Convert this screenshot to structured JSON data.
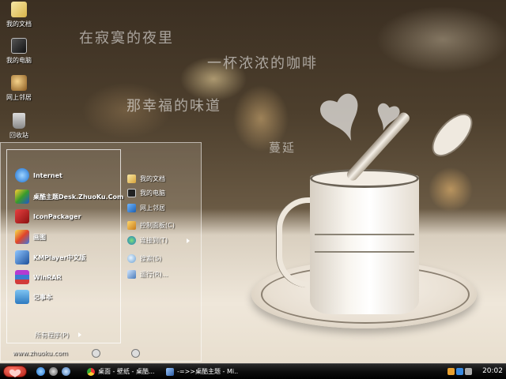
{
  "desktop": {
    "icons": [
      {
        "label": "我的文档",
        "icon": "my-documents-icon"
      },
      {
        "label": "我的电脑",
        "icon": "my-computer-icon"
      },
      {
        "label": "网上邻居",
        "icon": "network-places-icon"
      },
      {
        "label": "回收站",
        "icon": "recycle-bin-icon"
      }
    ],
    "wallpaper_text": [
      "在寂寞的夜里",
      "一杯浓浓的咖啡",
      "那幸福的味道",
      "蔓延"
    ]
  },
  "start_menu": {
    "pinned": [
      {
        "label": "Internet",
        "icon": "internet-explorer-icon"
      },
      {
        "label": "桌酷主题Desk.ZhuoKu.Com",
        "icon": "zhuoku-theme-icon"
      },
      {
        "label": "IconPackager",
        "icon": "iconpackager-icon"
      },
      {
        "label": "画图",
        "icon": "paint-icon"
      },
      {
        "label": "KMPlayer中文版",
        "icon": "kmplayer-icon"
      },
      {
        "label": "WinRAR",
        "icon": "winrar-icon"
      },
      {
        "label": "记事本",
        "icon": "notepad-icon"
      }
    ],
    "all_programs_label": "所有程序(P)",
    "places": [
      {
        "label": "我的文档",
        "icon": "folder-icon"
      },
      {
        "label": "我的电脑",
        "icon": "computer-icon"
      },
      {
        "label": "网上邻居",
        "icon": "network-icon"
      },
      {
        "label": "控制面板(C)",
        "icon": "control-panel-icon"
      },
      {
        "label": "连接到(T)",
        "icon": "connect-to-icon"
      },
      {
        "label": "搜索(S)",
        "icon": "search-icon"
      },
      {
        "label": "运行(R)...",
        "icon": "run-icon"
      }
    ],
    "footer_url": "www.zhuoku.com"
  },
  "taskbar": {
    "tasks": [
      {
        "label": "桌面 - 壁纸 - 桌酷...",
        "icon": "chrome-icon"
      },
      {
        "label": "-=>>桌酷主题 - Mi...",
        "icon": "window-icon"
      }
    ],
    "clock": "20:02"
  },
  "colors": {
    "accent": "#b21c12",
    "taskbar": "#0d0d0d"
  }
}
